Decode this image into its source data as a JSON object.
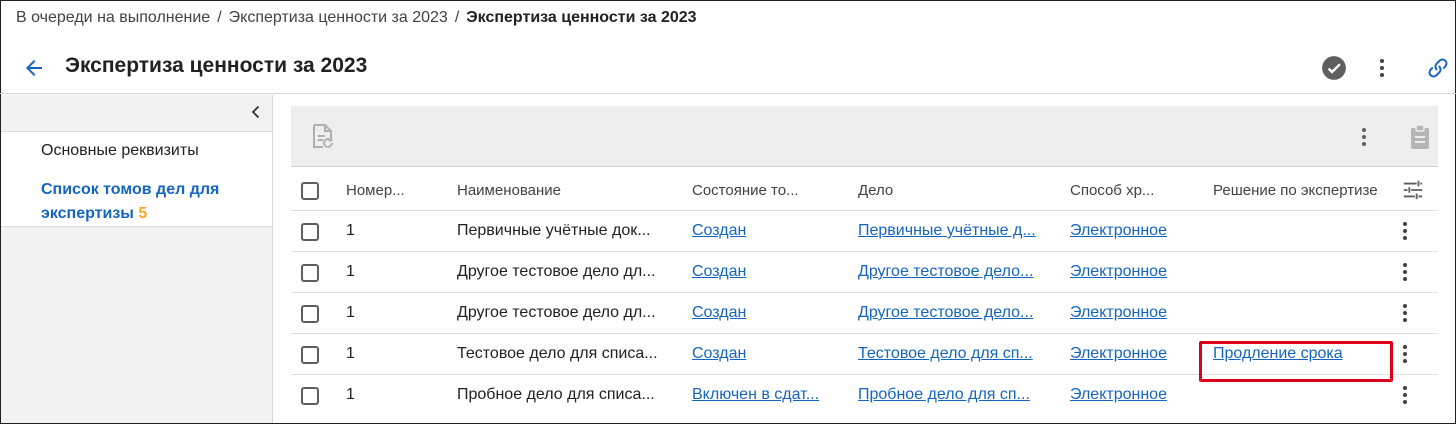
{
  "breadcrumb": {
    "items": [
      "В очереди на выполнение",
      "Экспертиза ценности за 2023",
      "Экспертиза ценности за 2023"
    ],
    "separator": "/"
  },
  "header": {
    "title": "Экспертиза ценности за 2023",
    "icons": [
      "back-arrow-icon",
      "check-circle-icon",
      "more-vertical-icon",
      "link-icon"
    ]
  },
  "sidebar": {
    "items": [
      {
        "label": "Основные реквизиты"
      },
      {
        "label": "Список томов дел для экспертизы",
        "count": "5"
      }
    ]
  },
  "table": {
    "columns": [
      "Номер...",
      "Наименование",
      "Состояние то...",
      "Дело",
      "Способ хр...",
      "Решение по экспертизе"
    ],
    "rows": [
      {
        "number": "1",
        "name": "Первичные учётные док...",
        "state": "Создан",
        "case": "Первичные учётные д...",
        "storage": "Электронное",
        "decision": ""
      },
      {
        "number": "1",
        "name": "Другое тестовое дело дл...",
        "state": "Создан",
        "case": "Другое тестовое дело...",
        "storage": "Электронное",
        "decision": ""
      },
      {
        "number": "1",
        "name": "Другое тестовое дело дл...",
        "state": "Создан",
        "case": "Другое тестовое дело...",
        "storage": "Электронное",
        "decision": ""
      },
      {
        "number": "1",
        "name": "Тестовое дело для списа...",
        "state": "Создан",
        "case": "Тестовое дело для сп...",
        "storage": "Электронное",
        "decision": "Продление срока"
      },
      {
        "number": "1",
        "name": "Пробное дело для списа...",
        "state": "Включен в сдат...",
        "case": "Пробное дело для сп...",
        "storage": "Электронное",
        "decision": ""
      }
    ]
  },
  "colors": {
    "accent": "#1565c0",
    "count": "#f5a623",
    "highlight": "#e0001a"
  }
}
